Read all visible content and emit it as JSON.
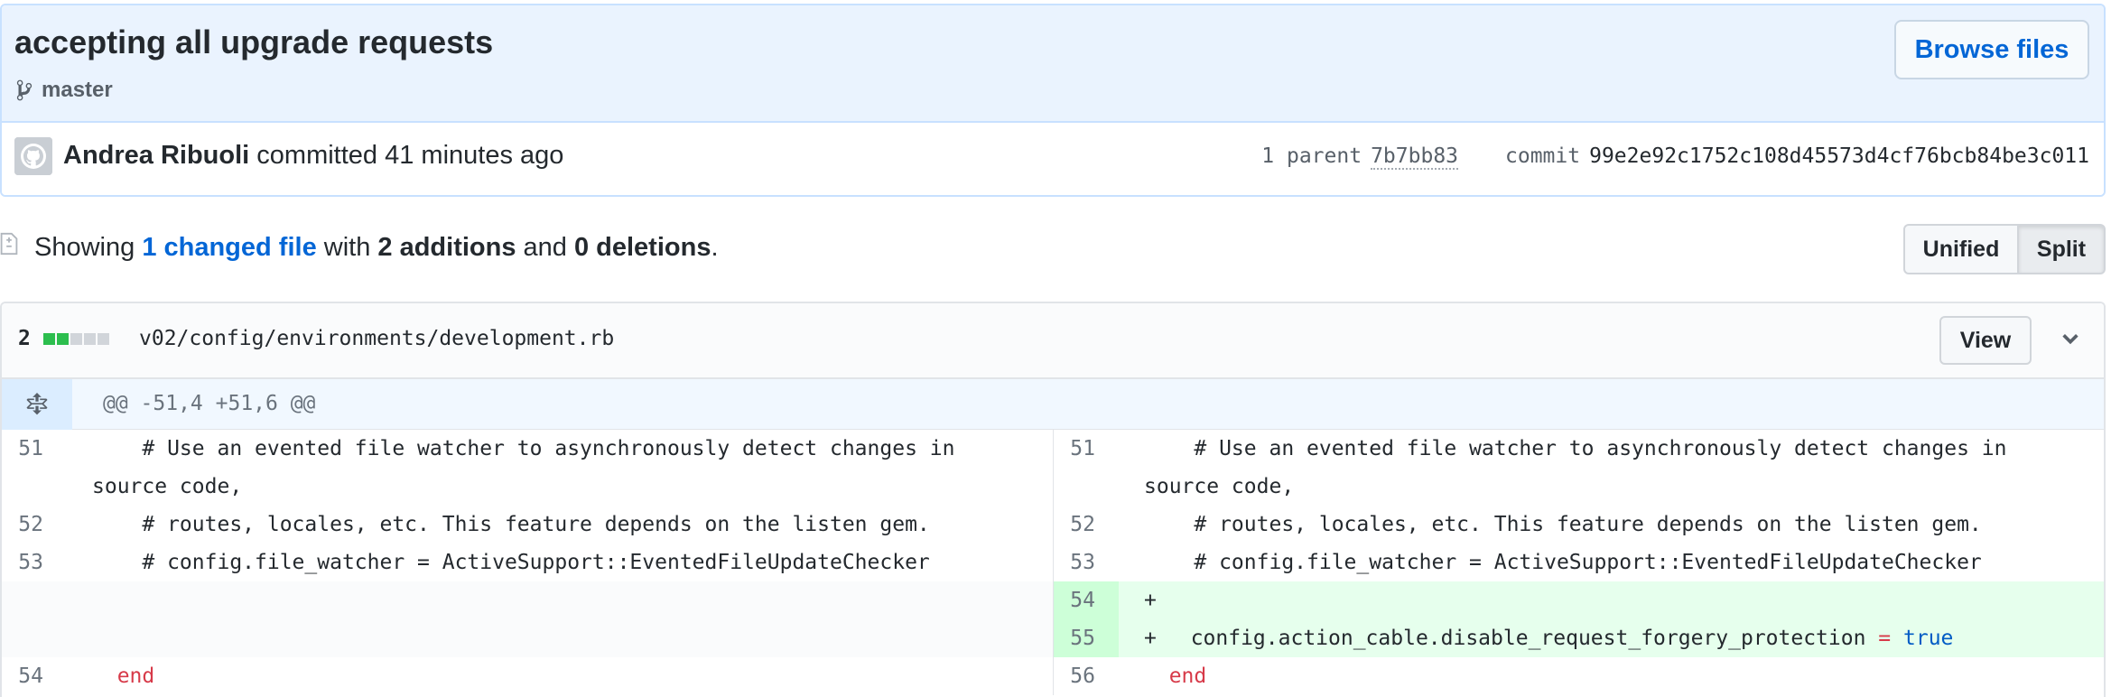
{
  "commit": {
    "title": "accepting all upgrade requests",
    "branch": "master",
    "browse_label": "Browse files",
    "author": "Andrea Ribuoli",
    "action_text": " committed 41 minutes ago",
    "parent_label": "1 parent",
    "parent_sha": "7b7bb83",
    "commit_label": "commit",
    "sha": "99e2e92c1752c108d45573d4cf76bcb84be3c011"
  },
  "toc": {
    "showing": "Showing ",
    "changed_files": "1 changed file",
    "with": " with ",
    "additions": "2 additions",
    "and": " and ",
    "deletions": "0 deletions",
    "period": "."
  },
  "view_toggle": {
    "unified": "Unified",
    "split": "Split",
    "selected": "Split"
  },
  "file": {
    "change_count": "2",
    "path": "v02/config/environments/development.rb",
    "view_label": "View",
    "hunk_header": "@@ -51,4 +51,6 @@",
    "left": [
      {
        "num": "51",
        "code": "    # Use an evented file watcher to asynchronously detect changes in source code,"
      },
      {
        "num": "52",
        "code": "    # routes, locales, etc. This feature depends on the listen gem."
      },
      {
        "num": "53",
        "code": "    # config.file_watcher = ActiveSupport::EventedFileUpdateChecker"
      },
      {
        "num": "54",
        "code": "end"
      }
    ],
    "right": [
      {
        "num": "51",
        "code": "    # Use an evented file watcher to asynchronously detect changes in source code,"
      },
      {
        "num": "52",
        "code": "    # routes, locales, etc. This feature depends on the listen gem."
      },
      {
        "num": "53",
        "code": "    # config.file_watcher = ActiveSupport::EventedFileUpdateChecker"
      },
      {
        "num": "54",
        "sign": "+",
        "code": ""
      },
      {
        "num": "55",
        "sign": "+",
        "code_pre": "  config.action_cable.disable_request_forgery_protection ",
        "op": "=",
        "value": "true"
      },
      {
        "num": "56",
        "code": "end"
      }
    ]
  },
  "colors": {
    "link": "#0366d6",
    "added_bg": "#e6ffed",
    "added_num_bg": "#cdffd8",
    "diffstat_add": "#2cbe4e",
    "keyword": "#d73a49"
  }
}
